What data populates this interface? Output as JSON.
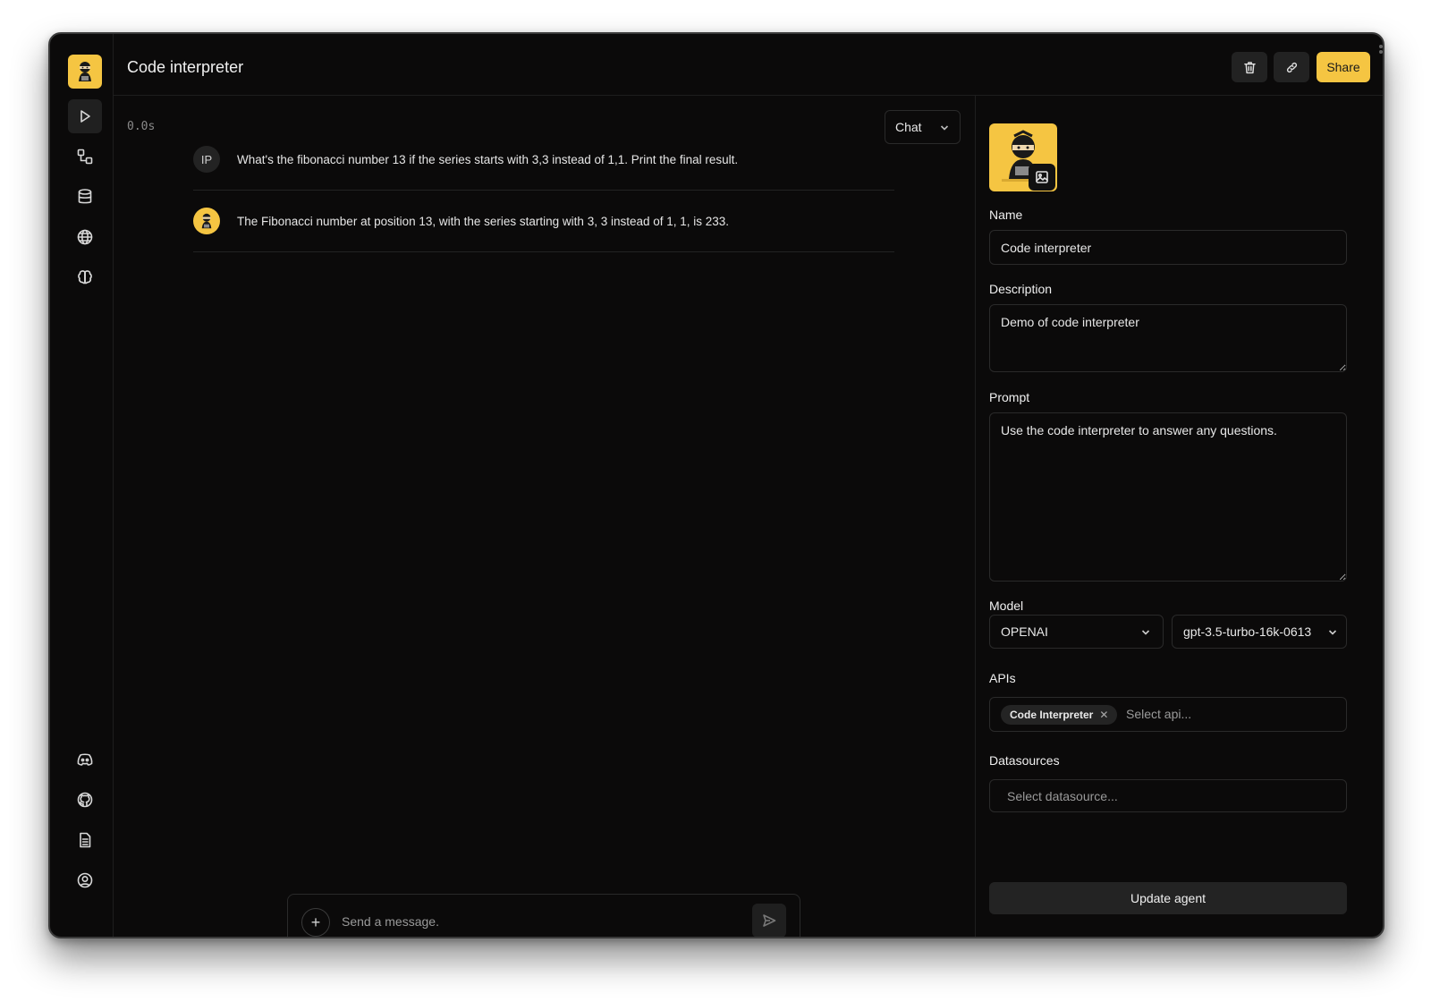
{
  "app": {
    "title": "Code interpreter"
  },
  "sidebar": {
    "items": [
      {
        "icon": "play-icon",
        "label": "Playground",
        "active": true
      },
      {
        "icon": "workflow-icon",
        "label": "Workflows"
      },
      {
        "icon": "database-icon",
        "label": "Datasources"
      },
      {
        "icon": "globe-icon",
        "label": "APIs"
      },
      {
        "icon": "brain-icon",
        "label": "LLMs"
      }
    ],
    "bottom_items": [
      {
        "icon": "discord-icon"
      },
      {
        "icon": "github-icon"
      },
      {
        "icon": "docs-icon"
      },
      {
        "icon": "user-circle-icon"
      }
    ]
  },
  "header": {
    "share_label": "Share",
    "delete_icon": "trash-icon",
    "link_icon": "link-icon"
  },
  "chat": {
    "timer": "0.0s",
    "mode_label": "Chat",
    "messages": [
      {
        "role": "user",
        "avatar_text": "IP",
        "text": "What's the fibonacci number 13 if the series starts with 3,3 instead of 1,1. Print the final result."
      },
      {
        "role": "assistant",
        "avatar_icon": "agent-avatar-icon",
        "text": "The Fibonacci number at position 13, with the series starting with 3, 3 instead of 1, 1, is 233."
      }
    ],
    "composer": {
      "placeholder": "Send a message.",
      "plus_label": "+"
    }
  },
  "panel": {
    "name_label": "Name",
    "name_value": "Code interpreter",
    "description_label": "Description",
    "description_value": "Demo of code interpreter",
    "prompt_label": "Prompt",
    "prompt_value": "Use the code interpreter to answer any questions.",
    "model_label": "Model",
    "model_provider": "OPENAI",
    "model_name": "gpt-3.5-turbo-16k-0613",
    "apis_label": "APIs",
    "apis_selected": [
      "Code Interpreter"
    ],
    "apis_placeholder": "Select api...",
    "datasources_label": "Datasources",
    "datasources_placeholder": "Select datasource...",
    "update_label": "Update agent"
  },
  "colors": {
    "accent": "#f5c542",
    "background": "#0b0a0a",
    "border": "#2a2a2a"
  }
}
